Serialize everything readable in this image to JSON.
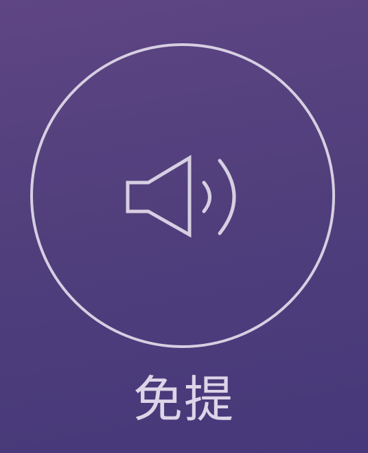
{
  "speaker": {
    "label": "免提",
    "icon": "speaker-icon",
    "state": "off",
    "accent_color": "#d6cfe2",
    "background_top": "#5f4584",
    "background_bottom": "#46387a"
  }
}
